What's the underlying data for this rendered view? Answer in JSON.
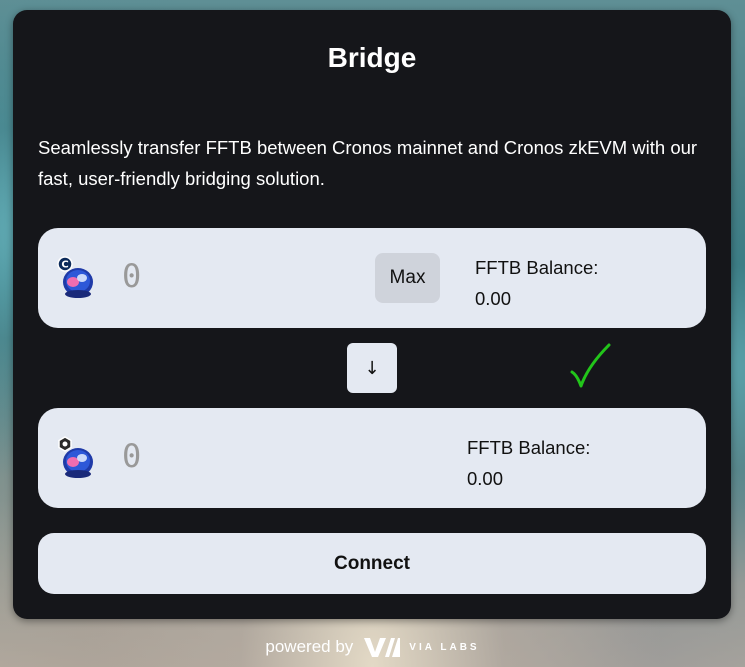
{
  "bridge": {
    "title": "Bridge",
    "description": "Seamlessly transfer FFTB between Cronos mainnet and Cronos zkEVM with our fast, user-friendly bridging solution."
  },
  "from": {
    "amount_placeholder": "0",
    "max_label": "Max",
    "balance_label": "FFTB Balance:",
    "balance_value": "0.00",
    "network_icon": "cronos-mainnet-icon"
  },
  "to": {
    "amount_placeholder": "0",
    "balance_label": "FFTB Balance:",
    "balance_value": "0.00",
    "network_icon": "cronos-zkevm-icon"
  },
  "swap": {
    "arrow": "↓"
  },
  "status": {
    "check_color": "#22c51a"
  },
  "connect": {
    "label": "Connect"
  },
  "footer": {
    "powered_by": "powered by",
    "brand": "VIA LABS"
  },
  "colors": {
    "card_bg": "#15161a",
    "panel_bg": "#e4e9f2",
    "max_bg": "#cfd3db"
  }
}
